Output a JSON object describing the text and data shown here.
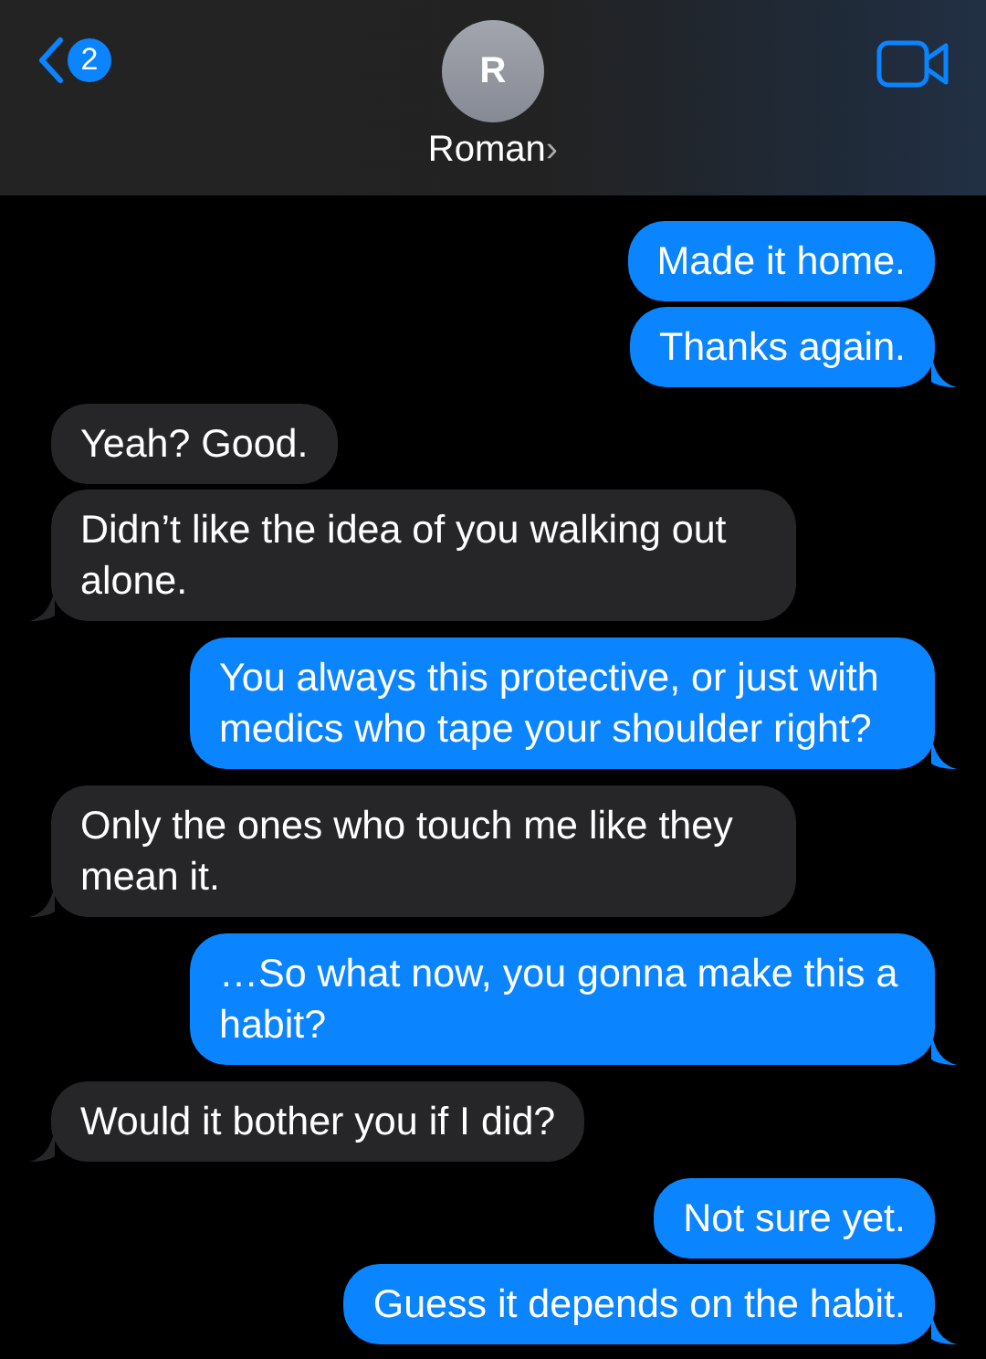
{
  "header": {
    "unread_count": "2",
    "avatar_initial": "R",
    "contact_name": "Roman",
    "name_chevron": "›"
  },
  "messages": [
    {
      "kind": "sent",
      "text": "Made it home.",
      "tail": false
    },
    {
      "kind": "sent",
      "text": "Thanks again.",
      "tail": true
    },
    {
      "kind": "received",
      "text": "Yeah? Good.",
      "tail": false
    },
    {
      "kind": "received",
      "text": "Didn’t like the idea of you walking out alone.",
      "tail": true
    },
    {
      "kind": "sent",
      "text": "You always this protective, or just with medics who tape your shoulder right?",
      "tail": true
    },
    {
      "kind": "received",
      "text": "Only the ones who touch me like they mean it.",
      "tail": true
    },
    {
      "kind": "sent",
      "text": "…So what now, you gonna make this a habit?",
      "tail": true
    },
    {
      "kind": "received",
      "text": "Would it bother you if I did?",
      "tail": true
    },
    {
      "kind": "sent",
      "text": "Not sure yet.",
      "tail": false
    },
    {
      "kind": "sent",
      "text": "Guess it depends on the habit.",
      "tail": true
    }
  ]
}
